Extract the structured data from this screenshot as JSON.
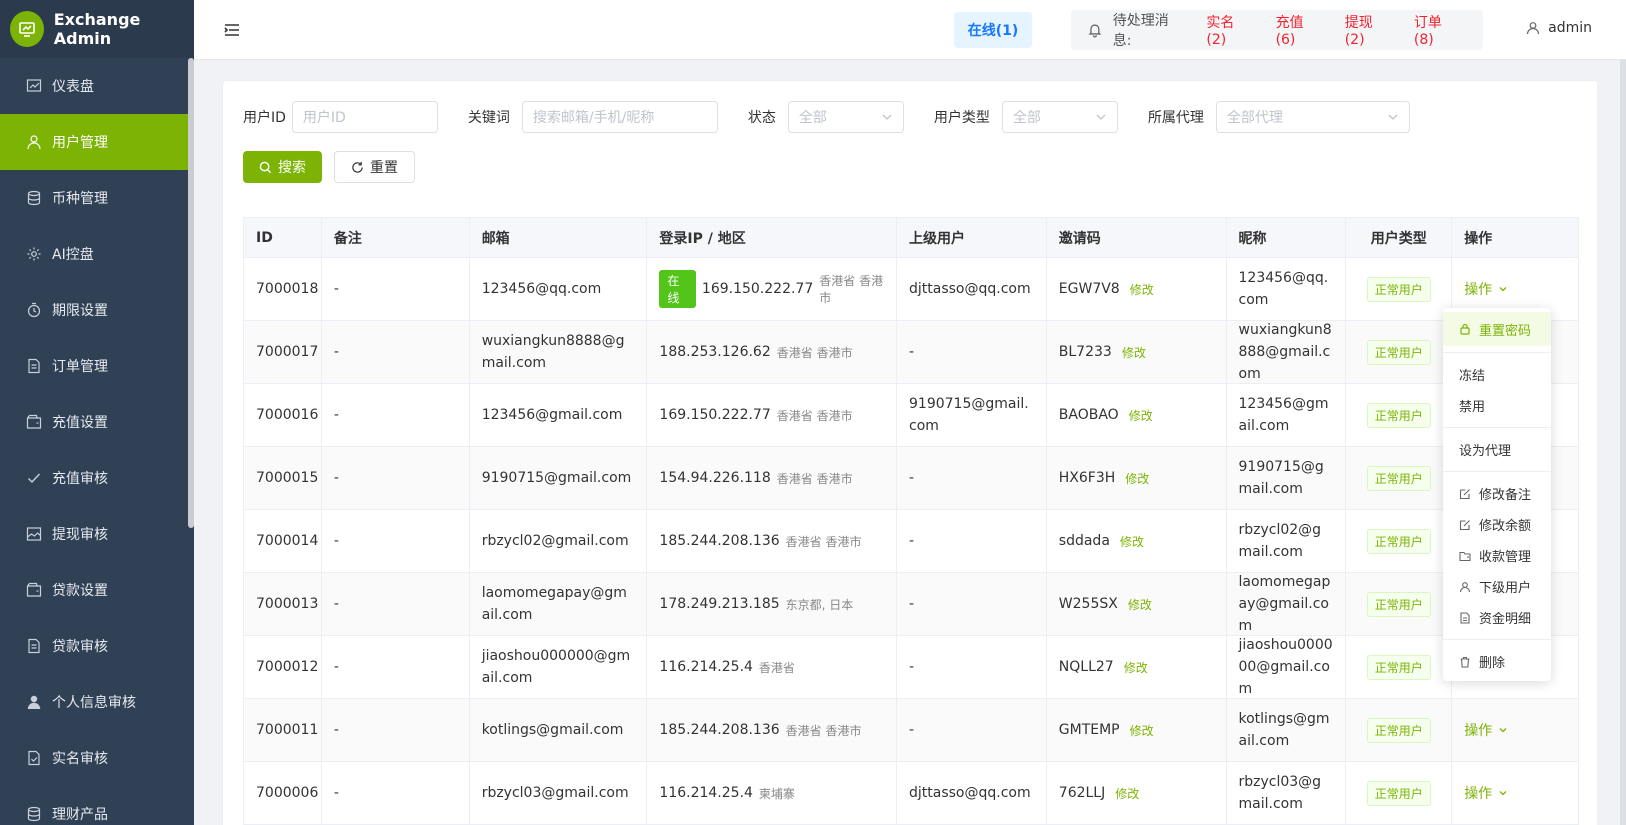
{
  "brand": {
    "title": "Exchange Admin"
  },
  "sidebar": {
    "items": [
      {
        "label": "仪表盘",
        "icon": "chart-icon"
      },
      {
        "label": "用户管理",
        "icon": "user-icon",
        "active": true
      },
      {
        "label": "币种管理",
        "icon": "database-icon"
      },
      {
        "label": "AI控盘",
        "icon": "gear-icon"
      },
      {
        "label": "期限设置",
        "icon": "timer-icon"
      },
      {
        "label": "订单管理",
        "icon": "document-icon"
      },
      {
        "label": "充值设置",
        "icon": "wallet-icon"
      },
      {
        "label": "充值审核",
        "icon": "check-icon"
      },
      {
        "label": "提现审核",
        "icon": "image-icon"
      },
      {
        "label": "贷款设置",
        "icon": "wallet-icon"
      },
      {
        "label": "贷款审核",
        "icon": "document-icon"
      },
      {
        "label": "个人信息审核",
        "icon": "person-icon"
      },
      {
        "label": "实名审核",
        "icon": "document-check-icon"
      },
      {
        "label": "理财产品",
        "icon": "database-icon"
      }
    ]
  },
  "header": {
    "online": "在线(1)",
    "notice_label": "待处理消息:",
    "notices": [
      "实名(2)",
      "充值(6)",
      "提现(2)",
      "订单(8)"
    ],
    "user": "admin"
  },
  "filters": {
    "user_id_label": "用户ID",
    "user_id_placeholder": "用户ID",
    "keyword_label": "关键词",
    "keyword_placeholder": "搜索邮箱/手机/昵称",
    "status_label": "状态",
    "status_value": "全部",
    "type_label": "用户类型",
    "type_value": "全部",
    "agent_label": "所属代理",
    "agent_value": "全部代理",
    "search_btn": "搜索",
    "reset_btn": "重置"
  },
  "table": {
    "headers": [
      "ID",
      "备注",
      "邮箱",
      "登录IP / 地区",
      "上级用户",
      "邀请码",
      "昵称",
      "用户类型",
      "操作"
    ],
    "edit_label": "修改",
    "online_tag": "在线",
    "op_label": "操作",
    "rows": [
      {
        "id": "7000018",
        "note": "-",
        "email": "123456@qq.com",
        "ip": "169.150.222.77",
        "region": "香港省 香港市",
        "online": true,
        "parent": "djttasso@qq.com",
        "code": "EGW7V8",
        "nick": "123456@qq.com",
        "type": "正常用户"
      },
      {
        "id": "7000017",
        "note": "-",
        "email": "wuxiangkun8888@gmail.com",
        "ip": "188.253.126.62",
        "region": "香港省 香港市",
        "online": false,
        "parent": "-",
        "code": "BL7233",
        "nick": "wuxiangkun8888@gmail.com",
        "type": "正常用户"
      },
      {
        "id": "7000016",
        "note": "-",
        "email": "123456@gmail.com",
        "ip": "169.150.222.77",
        "region": "香港省 香港市",
        "online": false,
        "parent": "9190715@gmail.com",
        "code": "BAOBAO",
        "nick": "123456@gmail.com",
        "type": "正常用户"
      },
      {
        "id": "7000015",
        "note": "-",
        "email": "9190715@gmail.com",
        "ip": "154.94.226.118",
        "region": "香港省 香港市",
        "online": false,
        "parent": "-",
        "code": "HX6F3H",
        "nick": "9190715@gmail.com",
        "type": "正常用户"
      },
      {
        "id": "7000014",
        "note": "-",
        "email": "rbzycl02@gmail.com",
        "ip": "185.244.208.136",
        "region": "香港省 香港市",
        "online": false,
        "parent": "-",
        "code": "sddada",
        "nick": "rbzycl02@gmail.com",
        "type": "正常用户"
      },
      {
        "id": "7000013",
        "note": "-",
        "email": "laomomegapay@gmail.com",
        "ip": "178.249.213.185",
        "region": "东京都, 日本",
        "online": false,
        "parent": "-",
        "code": "W255SX",
        "nick": "laomomegapay@gmail.com",
        "type": "正常用户"
      },
      {
        "id": "7000012",
        "note": "-",
        "email": "jiaoshou000000@gmail.com",
        "ip": "116.214.25.4",
        "region": "香港省",
        "online": false,
        "parent": "-",
        "code": "NQLL27",
        "nick": "jiaoshou000000@gmail.com",
        "type": "正常用户"
      },
      {
        "id": "7000011",
        "note": "-",
        "email": "kotlings@gmail.com",
        "ip": "185.244.208.136",
        "region": "香港省 香港市",
        "online": false,
        "parent": "-",
        "code": "GMTEMP",
        "nick": "kotlings@gmail.com",
        "type": "正常用户"
      },
      {
        "id": "7000006",
        "note": "-",
        "email": "rbzycl03@gmail.com",
        "ip": "116.214.25.4",
        "region": "柬埔寨",
        "online": false,
        "parent": "djttasso@qq.com",
        "code": "762LLJ",
        "nick": "rbzycl03@gmail.com",
        "type": "正常用户"
      }
    ]
  },
  "dropdown": {
    "items": [
      {
        "label": "重置密码",
        "icon": "lock-icon",
        "active": true
      },
      {
        "divider": true
      },
      {
        "label": "冻结"
      },
      {
        "label": "禁用"
      },
      {
        "divider": true
      },
      {
        "label": "设为代理"
      },
      {
        "divider": true
      },
      {
        "label": "修改备注",
        "icon": "edit-icon"
      },
      {
        "label": "修改余额",
        "icon": "edit-icon"
      },
      {
        "label": "收款管理",
        "icon": "folder-icon"
      },
      {
        "label": "下级用户",
        "icon": "user-icon"
      },
      {
        "label": "资金明细",
        "icon": "document-icon"
      },
      {
        "divider": true
      },
      {
        "label": "删除",
        "icon": "trash-icon"
      }
    ]
  },
  "colors": {
    "accent": "#7cb305",
    "sidebar_bg": "#304156",
    "danger": "#f5222d",
    "info": "#1677ff"
  }
}
